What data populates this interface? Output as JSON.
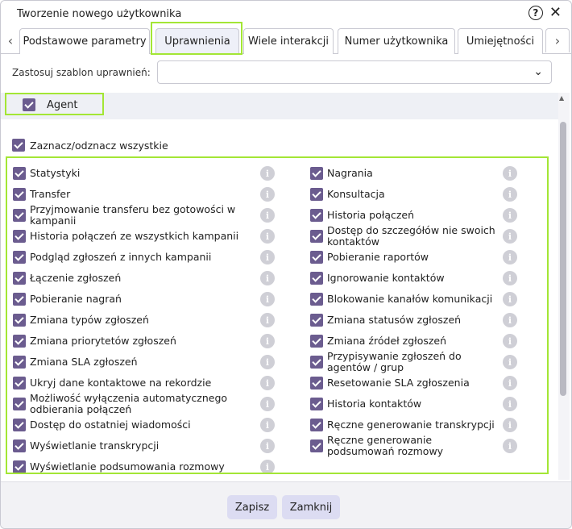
{
  "dialog": {
    "title": "Tworzenie nowego użytkownika"
  },
  "tabs": [
    {
      "label": "Podstawowe parametry"
    },
    {
      "label": "Uprawnienia",
      "active": true
    },
    {
      "label": "Wiele interakcji"
    },
    {
      "label": "Numer użytkownika"
    },
    {
      "label": "Umiejętności"
    }
  ],
  "template": {
    "label": "Zastosuj szablon uprawnień:",
    "value": ""
  },
  "agent": {
    "label": "Agent",
    "checked": true
  },
  "select_all": {
    "label": "Zaznacz/odznacz wszystkie"
  },
  "permissions_left": [
    {
      "label": "Statystyki"
    },
    {
      "label": "Transfer"
    },
    {
      "label": "Przyjmowanie transferu bez gotowości w kampanii"
    },
    {
      "label": "Historia połączeń ze wszystkich kampanii"
    },
    {
      "label": "Podgląd zgłoszeń z innych kampanii"
    },
    {
      "label": "Łączenie zgłoszeń"
    },
    {
      "label": "Pobieranie nagrań"
    },
    {
      "label": "Zmiana typów zgłoszeń"
    },
    {
      "label": "Zmiana priorytetów zgłoszeń"
    },
    {
      "label": "Zmiana SLA zgłoszeń"
    },
    {
      "label": "Ukryj dane kontaktowe na rekordzie"
    },
    {
      "label": "Możliwość wyłączenia automatycznego odbierania połączeń"
    },
    {
      "label": "Dostęp do ostatniej wiadomości"
    },
    {
      "label": "Wyświetlanie transkrypcji"
    },
    {
      "label": "Wyświetlanie podsumowania rozmowy"
    }
  ],
  "permissions_right": [
    {
      "label": "Nagrania"
    },
    {
      "label": "Konsultacja"
    },
    {
      "label": "Historia połączeń"
    },
    {
      "label": "Dostęp do szczegółów nie swoich kontaktów"
    },
    {
      "label": "Pobieranie raportów"
    },
    {
      "label": "Ignorowanie kontaktów"
    },
    {
      "label": "Blokowanie kanałów komunikacji"
    },
    {
      "label": "Zmiana statusów zgłoszeń"
    },
    {
      "label": "Zmiana źródeł zgłoszeń"
    },
    {
      "label": "Przypisywanie zgłoszeń do agentów / grup"
    },
    {
      "label": "Resetowanie SLA zgłoszenia"
    },
    {
      "label": "Historia kontaktów"
    },
    {
      "label": "Ręczne generowanie transkrypcji"
    },
    {
      "label": "Ręczne generowanie podsumowań rozmowy"
    }
  ],
  "footer": {
    "save_label": "Zapisz",
    "close_label": "Zamknij"
  },
  "colors": {
    "checkbox": "#6b5c8f",
    "highlight": "#a3e635",
    "button_bg": "#dcdcf2"
  },
  "icons": {
    "help": "help-icon",
    "close": "close-icon",
    "info": "info-icon",
    "chevron": "chevron-down-icon"
  }
}
